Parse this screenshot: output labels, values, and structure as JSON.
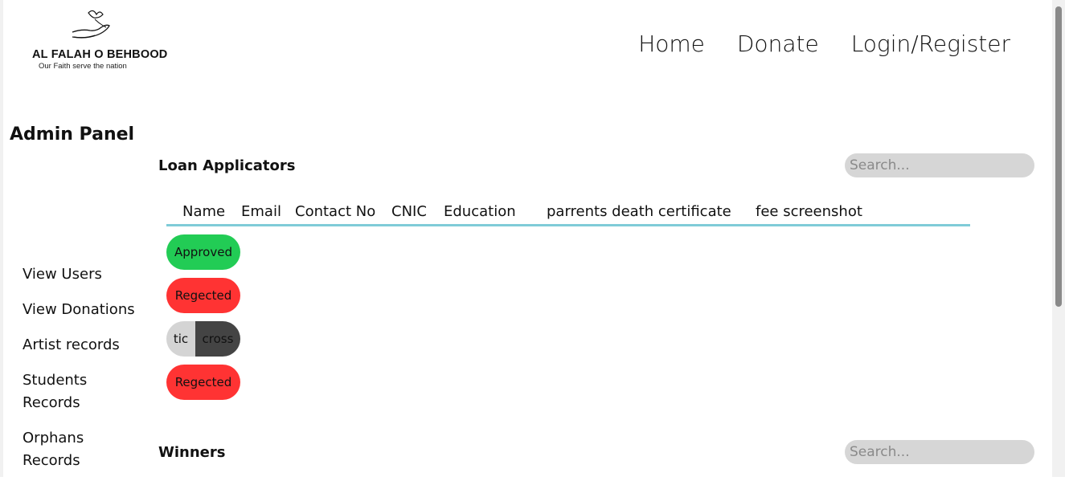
{
  "brand": {
    "name": "AL FALAH O BEHBOOD",
    "tagline": "Our Faith serve the nation"
  },
  "nav": {
    "home": "Home",
    "donate": "Donate",
    "login": "Login/Register"
  },
  "admin_title": "Admin Panel",
  "sidebar": {
    "items": [
      {
        "label": "View Users"
      },
      {
        "label": "View Donations"
      },
      {
        "label": "Artist records"
      },
      {
        "label": "Students Records"
      },
      {
        "label": "Orphans Records"
      }
    ]
  },
  "loan_section": {
    "title": "Loan Applicators",
    "search_placeholder": "Search...",
    "columns": [
      "Name",
      "Email",
      "Contact No",
      "CNIC",
      "Education",
      "parrents death certificate",
      "fee screenshot"
    ],
    "statuses": {
      "approved": "Approved",
      "rejected_1": "Regected",
      "rejected_2": "Regected"
    },
    "toggle": {
      "tic": "tic",
      "cross": "cross"
    }
  },
  "winners_section": {
    "title": "Winners",
    "search_placeholder": "Search..."
  },
  "colors": {
    "approved": "#22cc55",
    "rejected": "#ff3333",
    "table_rule": "#7fcbd8",
    "search_bg": "#d6d6d6"
  }
}
